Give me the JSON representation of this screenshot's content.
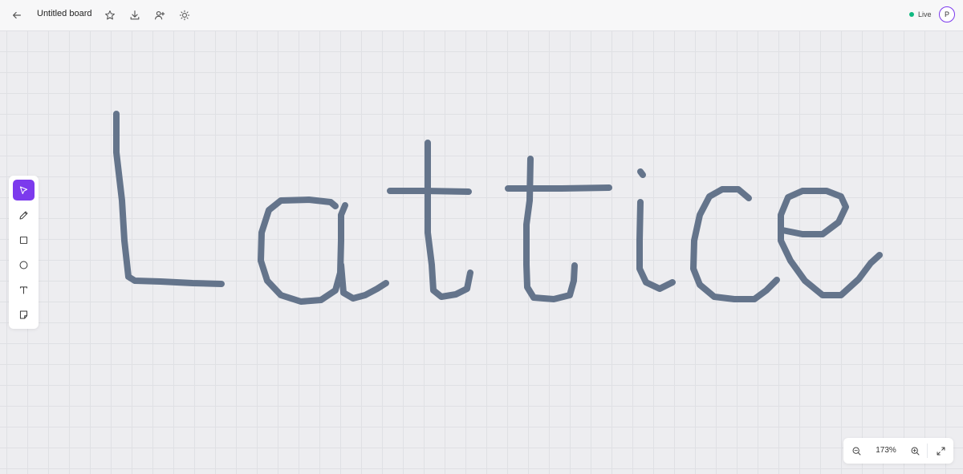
{
  "header": {
    "board_title": "Untitled board",
    "status_label": "Live",
    "avatar_initial": "P",
    "icons": [
      "back-arrow-icon",
      "star-icon",
      "download-icon",
      "add-user-icon",
      "theme-sun-icon"
    ]
  },
  "toolbar": {
    "tools": [
      {
        "name": "select",
        "icon": "cursor-arrow-icon",
        "active": true
      },
      {
        "name": "pen",
        "icon": "pencil-icon",
        "active": false
      },
      {
        "name": "rectangle",
        "icon": "square-icon",
        "active": false
      },
      {
        "name": "ellipse",
        "icon": "circle-icon",
        "active": false
      },
      {
        "name": "text",
        "icon": "text-icon",
        "active": false
      },
      {
        "name": "sticky-note",
        "icon": "note-icon",
        "active": false
      }
    ]
  },
  "zoom": {
    "level_label": "173%",
    "level_percent": 173
  },
  "canvas": {
    "stroke_color": "#64748b",
    "accent_color": "#7c3aed",
    "status_color": "#10b981"
  }
}
